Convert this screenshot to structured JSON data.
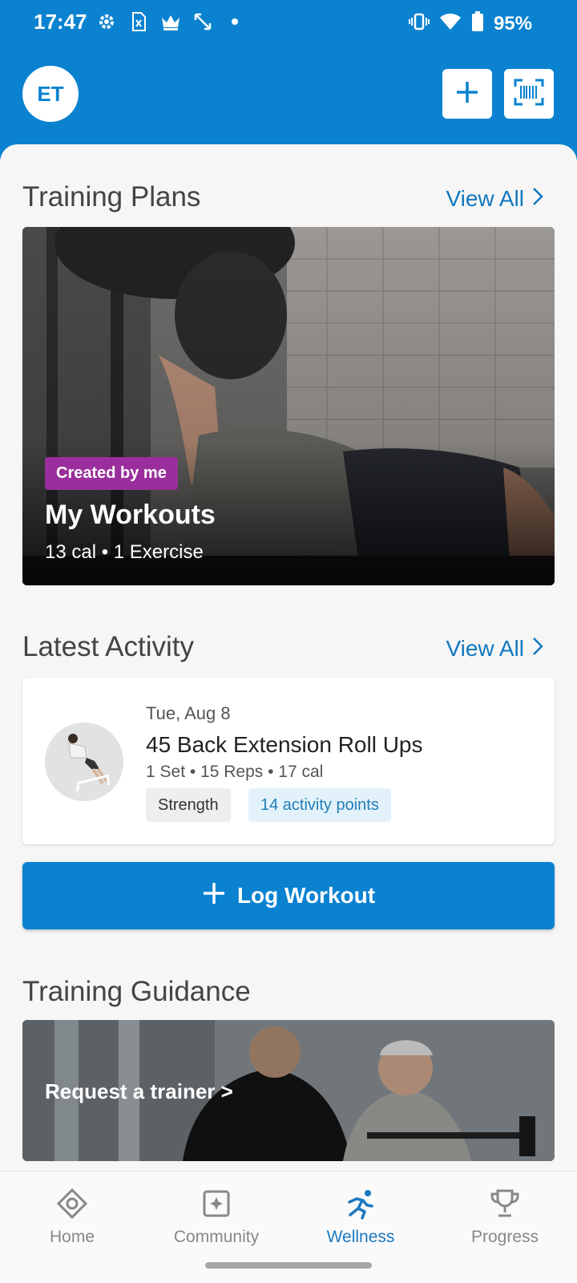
{
  "status_bar": {
    "time": "17:47",
    "battery": "95%",
    "icons": [
      "settings-icon",
      "sim-card-icon",
      "crown-icon",
      "expand-arrows-icon",
      "dot-icon",
      "vibrate-icon",
      "wifi-icon",
      "battery-icon"
    ]
  },
  "header": {
    "avatar_initials": "ET",
    "add_icon": "plus-icon",
    "scan_icon": "barcode-scan-icon",
    "accent": "#0a82d0"
  },
  "training_plans": {
    "title": "Training Plans",
    "view_all": "View All",
    "card": {
      "badge": "Created by me",
      "badge_color": "#9a2e9c",
      "name": "My Workouts",
      "meta": "13 cal • 1 Exercise"
    }
  },
  "latest_activity": {
    "title": "Latest Activity",
    "view_all": "View All",
    "item": {
      "date": "Tue, Aug 8",
      "name": "45 Back Extension Roll Ups",
      "meta": "1 Set • 15 Reps  • 17 cal",
      "tag": "Strength",
      "points": "14 activity points"
    }
  },
  "log_workout": {
    "label": "Log Workout"
  },
  "training_guidance": {
    "title": "Training Guidance",
    "cta": "Request a trainer >"
  },
  "bottom_nav": {
    "items": [
      {
        "label": "Home",
        "icon": "home-diamond-icon"
      },
      {
        "label": "Community",
        "icon": "community-icon"
      },
      {
        "label": "Wellness",
        "icon": "running-person-icon",
        "active": true
      },
      {
        "label": "Progress",
        "icon": "trophy-icon"
      }
    ]
  }
}
